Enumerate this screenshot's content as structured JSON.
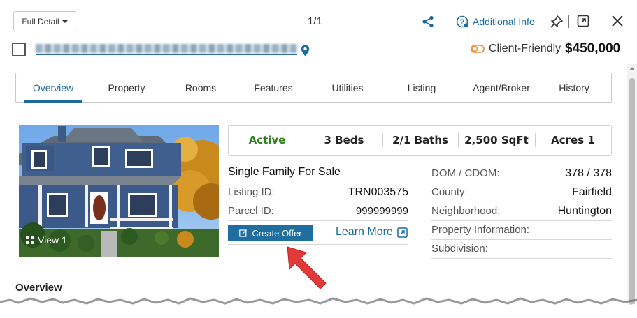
{
  "header": {
    "view_dropdown": "Full Detail",
    "pager": "1/1",
    "additional_info": "Additional Info"
  },
  "listing": {
    "client_friendly": "Client-Friendly",
    "price": "$450,000"
  },
  "tabs": [
    {
      "label": "Overview",
      "active": true
    },
    {
      "label": "Property"
    },
    {
      "label": "Rooms"
    },
    {
      "label": "Features"
    },
    {
      "label": "Utilities"
    },
    {
      "label": "Listing"
    },
    {
      "label": "Agent/Broker"
    },
    {
      "label": "History"
    }
  ],
  "photo": {
    "view_label": "View 1"
  },
  "stats": {
    "status": "Active",
    "beds": "3 Beds",
    "baths": "2/1 Baths",
    "sqft": "2,500 SqFt",
    "acres": "Acres 1"
  },
  "details_left": {
    "type": "Single Family For Sale",
    "listing_id_label": "Listing ID:",
    "listing_id": "TRN003575",
    "parcel_id_label": "Parcel ID:",
    "parcel_id": "999999999",
    "create_offer": "Create Offer",
    "learn_more": "Learn More"
  },
  "details_right": {
    "dom_label": "DOM / CDOM:",
    "dom_value": "378 / 378",
    "county_label": "County:",
    "county_value": "Fairfield",
    "neighborhood_label": "Neighborhood:",
    "neighborhood_value": "Huntington",
    "property_info_label": "Property Information:",
    "subdivision_label": "Subdivision:"
  },
  "overview": {
    "heading": "Overview"
  },
  "colors": {
    "accent": "#1c6a9e",
    "active_status": "#2e7d1c",
    "button": "#1f6e9f",
    "annotation_arrow": "#e23a3a",
    "toggle": "#f08c2a"
  },
  "icons": [
    "share-icon",
    "help-circle-icon",
    "pin-icon",
    "popout-icon",
    "close-icon",
    "map-pin-icon",
    "toggle-icon",
    "grid-icon",
    "edit-icon",
    "external-link-icon"
  ]
}
